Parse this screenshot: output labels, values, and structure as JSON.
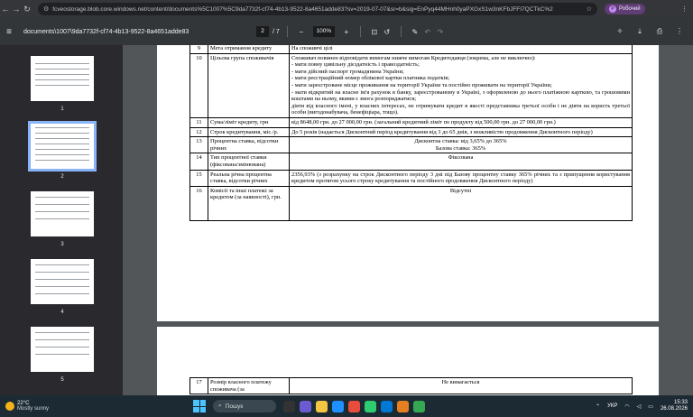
{
  "browser": {
    "url": "fcveostorage.blob.core.windows.net/content/documents%5C1007%5C9da7732f-cf74-4b13-9522-8a4651adde83?sv=2019-07-07&sr=b&sig=EnPyq44MHnh0yaPXGxS1w3nKFbJFFI7QCTkC%2",
    "profile_label": "Робочий",
    "profile_initial": "Р"
  },
  "pdf_toolbar": {
    "title": "documents\\1007\\9da7732f-cf74-4b13-9522-8a4651adde83",
    "page_current": "2",
    "page_total": "/ 7",
    "zoom": "100%"
  },
  "thumbnails": [
    "1",
    "2",
    "3",
    "4",
    "5"
  ],
  "table_rows": [
    {
      "num": "9",
      "label": "Мета отримання кредиту",
      "value": "На споживчі цілі"
    },
    {
      "num": "10",
      "label": "Цільова група споживачів",
      "value_lines": [
        "Споживач повинен відповідати вимогам нижче вимогам Кредитодавця (зокрема, але не виключно):",
        "- мати повну цивільну дієздатність і правоздатність;",
        "- мати дійсний паспорт громадянина України;",
        "- мати реєстраційний номер облікової картки платника податків;",
        "- мати зареєстроване місце проживання на території України та постійно проживати на території України;",
        "- мати відкритий на власне ім'я рахунок в банку, зареєстрованому в Україні, з оформленою до нього платіжною карткою, та грошовими коштами на ньому, якими є змога розпоряджатися;",
        "діяти від власного імені, у власних інтересах, не отримувати кредит в якості представника третьої особи і не діяти на користь третьої особи (вигодонабувача, бенефіціара, тощо)."
      ]
    },
    {
      "num": "11",
      "label": "Сума/ліміт кредиту, грн",
      "value": "від 8648,00 грн. до 27 000,00 грн. (загальний кредитний ліміт по продукту від 500,00 грн. до 27 000,00 грн.)"
    },
    {
      "num": "12",
      "label": "Строк кредитування, міс./р.",
      "value": "До 5 років (надається Дисконтний період кредитування від 3 до 65 днів, з можливістю продовження Дисконтного періоду)"
    },
    {
      "num": "13",
      "label": "Процентна ставка, відсотки річних",
      "value_lines": [
        "Дисконтна ставка: від 3,65% до 365%",
        "Базова ставка: 365%"
      ]
    },
    {
      "num": "14",
      "label": "Тип процентної ставки (фіксована/змінювана)",
      "value": "Фіксована"
    },
    {
      "num": "15",
      "label": "Реальна річна процентна ставка, відсотки річних",
      "value": "2356,93% (з розрахунку на строк Дисконтного періоду 3 дні під Базову процентну ставку 365% річних та з припущення користування кредитом протягом усього строку кредитування та постійного продовження Дисконтного періоду)"
    },
    {
      "num": "16",
      "label": "Комісії та інші платежі за кредитом (за наявності), грн.",
      "value": "Відсутні"
    },
    {
      "num": "17",
      "label": "Розмір власного платежу споживача (за",
      "value": "Не вимагається"
    }
  ],
  "taskbar": {
    "temp": "22°C",
    "weather": "Mostly sunny",
    "search_placeholder": "Пошук",
    "lang": "УКР",
    "time": "15:33",
    "date": "26.08.2026"
  }
}
